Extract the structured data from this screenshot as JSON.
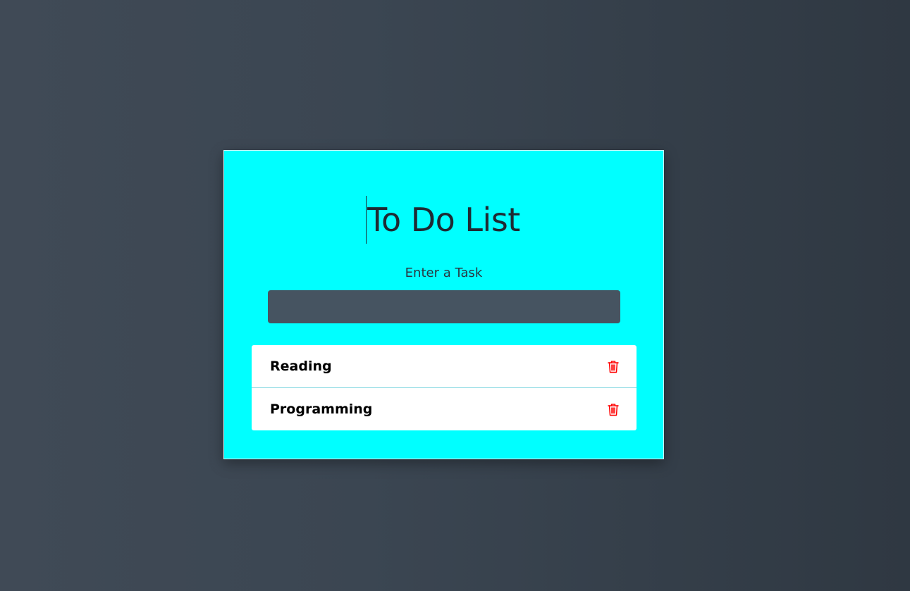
{
  "app": {
    "title": "To Do List",
    "input_label": "Enter a Task",
    "input_value": "",
    "input_placeholder": ""
  },
  "tasks": [
    {
      "text": "Reading",
      "action_icon": "trash-icon"
    },
    {
      "text": "Programming",
      "action_icon": "trash-icon"
    }
  ],
  "colors": {
    "background_left": "#404a56",
    "background_right": "#2f3842",
    "card": "#00ffff",
    "input": "#465461",
    "list_background": "#ffffff",
    "divider": "#7fd6df",
    "delete_icon": "#ff0000",
    "title_text": "#1f2a33"
  }
}
